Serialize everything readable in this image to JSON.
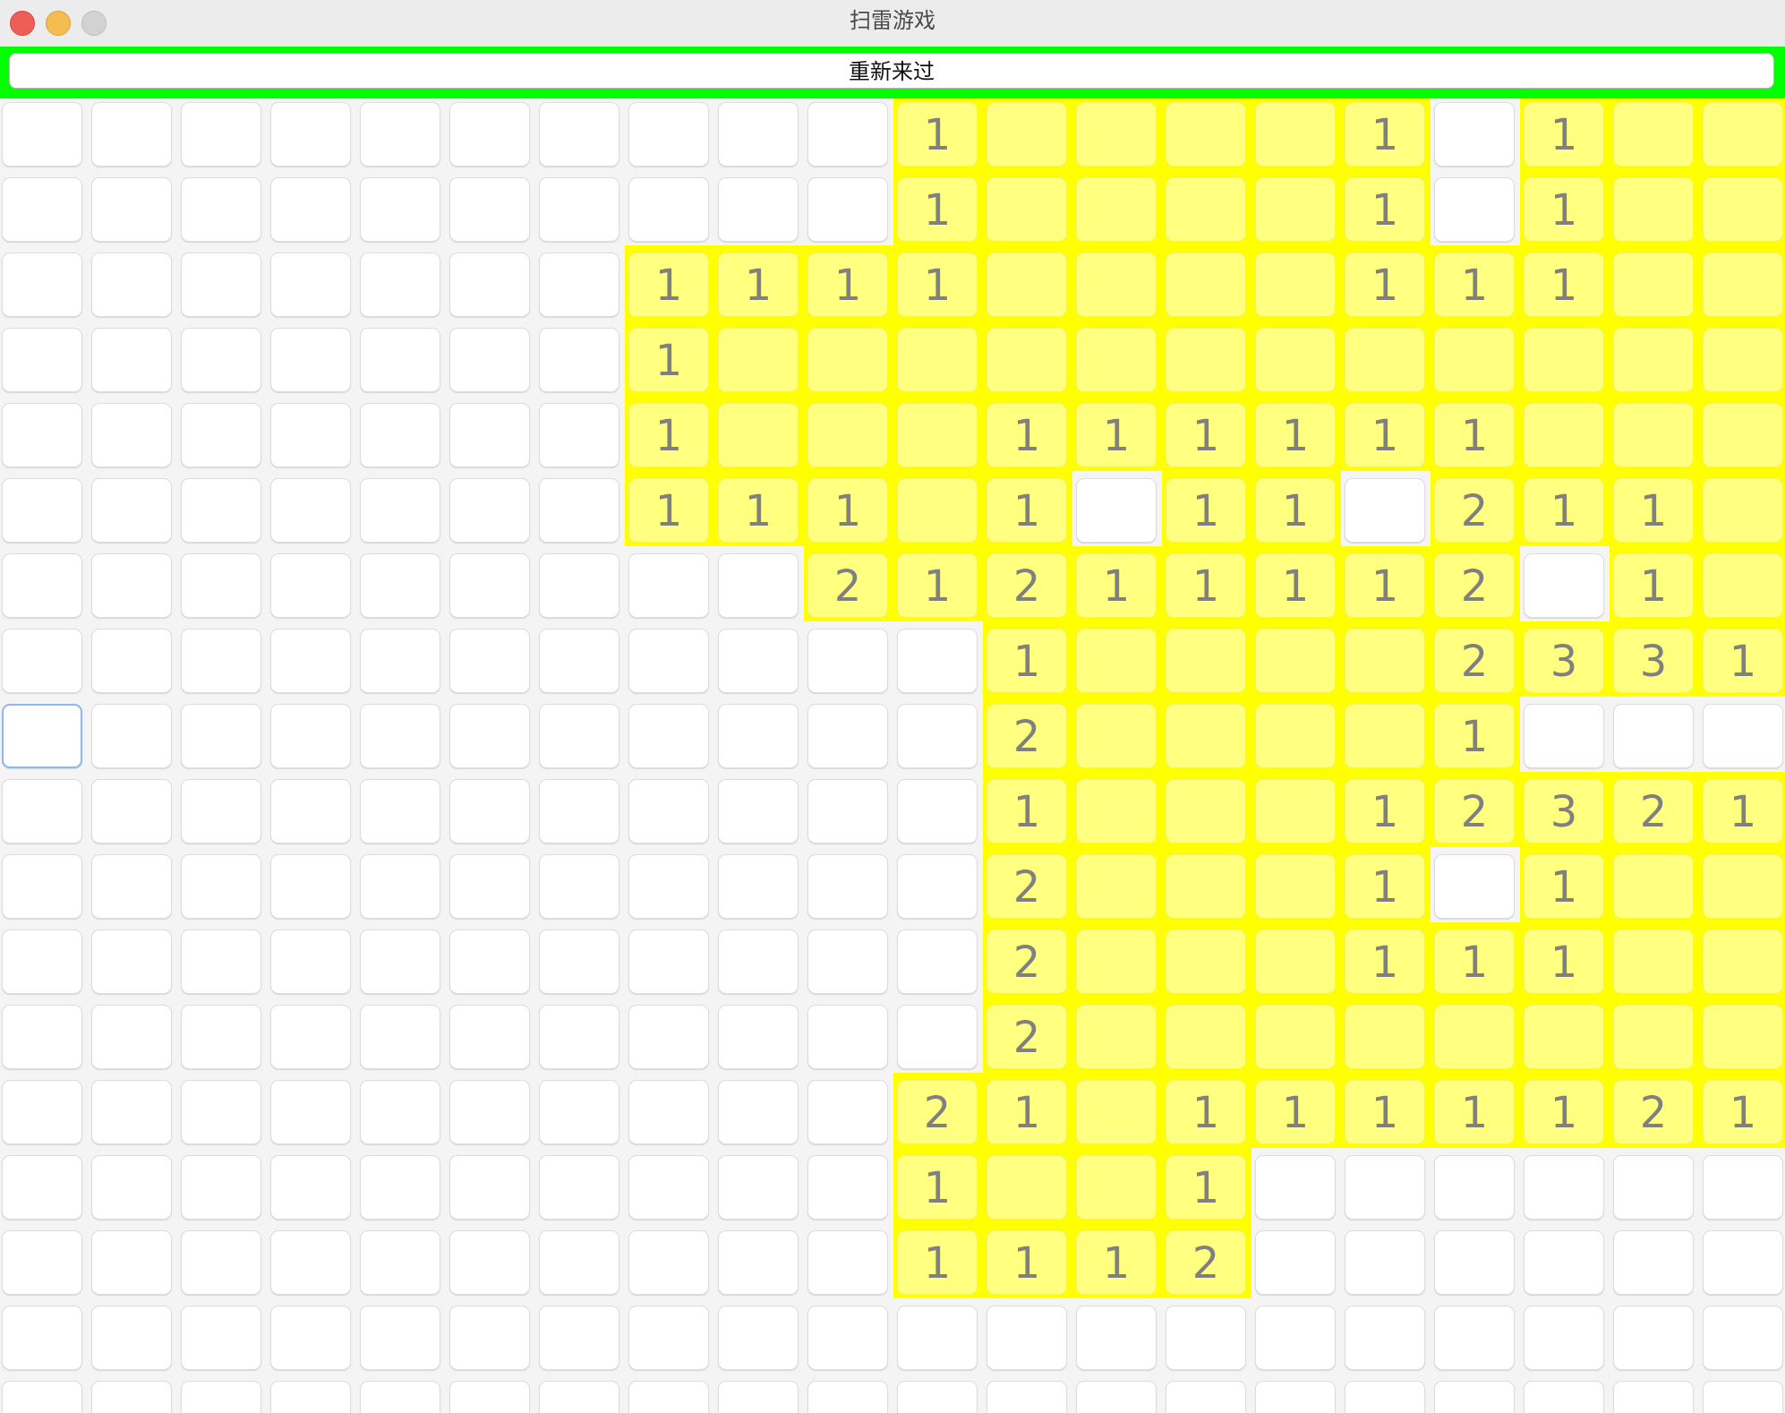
{
  "window": {
    "title": "扫雷游戏"
  },
  "toolbar": {
    "restart_label": "重新来过"
  },
  "colors": {
    "restart_bar": "#00ff00",
    "open_area": "#ffff00",
    "open_cell": "#ffff80",
    "hidden_cell": "#ffffff",
    "number_text": "#808080",
    "focus_ring": "#8bb8ee"
  },
  "board": {
    "rows": 18,
    "cols": 20,
    "focused_cell": [
      8,
      0
    ],
    "legend": "H = unrevealed, . = revealed empty, digit = revealed with count",
    "grid": [
      "HHHHHHHHHH1....1H1..",
      "HHHHHHHHHH1....1H1..",
      "HHHHHHH1111....111..",
      "HHHHHHH1............",
      "HHHHHHH1...111111...",
      "HHHHHHH111.1H11H211.",
      "HHHHHHHHH21211112H1.",
      "HHHHHHHHHHH1....2331",
      "HHHHHHHHHHH2....1HHH",
      "HHHHHHHHHHH1...12321",
      "HHHHHHHHHHH2...1H1..",
      "HHHHHHHHHHH2...111..",
      "HHHHHHHHHHH2........",
      "HHHHHHHHHH21.1111121",
      "HHHHHHHHHH1..1HHHHHH",
      "HHHHHHHHHH1112HHHHHH",
      "HHHHHHHHHHHHHHHHHHHH",
      "HHHHHHHHHHHHHHHHHHHH"
    ]
  }
}
